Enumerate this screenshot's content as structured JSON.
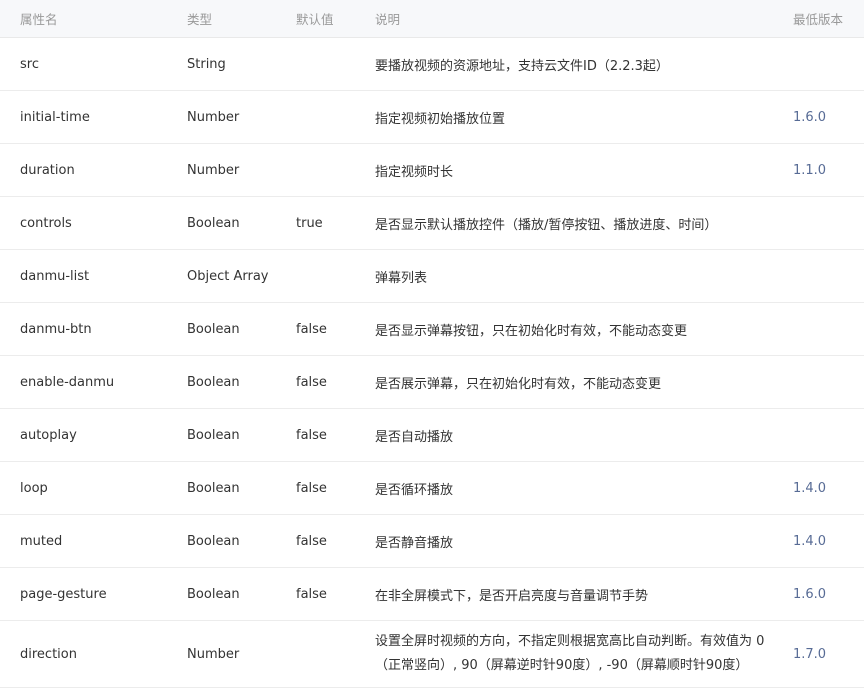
{
  "table": {
    "headers": {
      "name": "属性名",
      "type": "类型",
      "default": "默认值",
      "description": "说明",
      "version": "最低版本"
    },
    "rows": [
      {
        "name": "src",
        "type": "String",
        "default": "",
        "description": "要播放视频的资源地址，支持云文件ID（2.2.3起）",
        "version": ""
      },
      {
        "name": "initial-time",
        "type": "Number",
        "default": "",
        "description": "指定视频初始播放位置",
        "version": "1.6.0"
      },
      {
        "name": "duration",
        "type": "Number",
        "default": "",
        "description": "指定视频时长",
        "version": "1.1.0"
      },
      {
        "name": "controls",
        "type": "Boolean",
        "default": "true",
        "description": "是否显示默认播放控件（播放/暂停按钮、播放进度、时间）",
        "version": ""
      },
      {
        "name": "danmu-list",
        "type": "Object Array",
        "default": "",
        "description": "弹幕列表",
        "version": ""
      },
      {
        "name": "danmu-btn",
        "type": "Boolean",
        "default": "false",
        "description": "是否显示弹幕按钮，只在初始化时有效，不能动态变更",
        "version": ""
      },
      {
        "name": "enable-danmu",
        "type": "Boolean",
        "default": "false",
        "description": "是否展示弹幕，只在初始化时有效，不能动态变更",
        "version": ""
      },
      {
        "name": "autoplay",
        "type": "Boolean",
        "default": "false",
        "description": "是否自动播放",
        "version": ""
      },
      {
        "name": "loop",
        "type": "Boolean",
        "default": "false",
        "description": "是否循环播放",
        "version": "1.4.0"
      },
      {
        "name": "muted",
        "type": "Boolean",
        "default": "false",
        "description": "是否静音播放",
        "version": "1.4.0"
      },
      {
        "name": "page-gesture",
        "type": "Boolean",
        "default": "false",
        "description": "在非全屏模式下，是否开启亮度与音量调节手势",
        "version": "1.6.0"
      },
      {
        "name": "direction",
        "type": "Number",
        "default": "",
        "description": "设置全屏时视频的方向，不指定则根据宽高比自动判断。有效值为 0（正常竖向）, 90（屏幕逆时针90度）, -90（屏幕顺时针90度）",
        "version": "1.7.0"
      }
    ]
  },
  "colors": {
    "header_bg": "#f7f8fa",
    "header_text": "#999999",
    "body_text": "#333333",
    "version_link": "#576b95",
    "border": "#ececec"
  }
}
